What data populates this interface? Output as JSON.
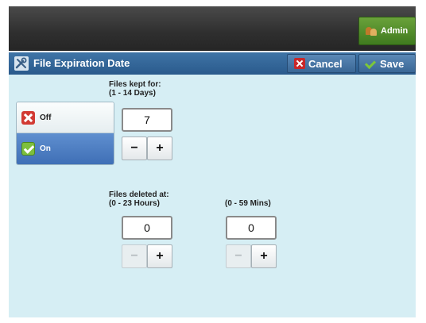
{
  "topbar": {
    "admin_label": "Admin"
  },
  "titlebar": {
    "title": "File Expiration Date",
    "cancel_label": "Cancel",
    "save_label": "Save"
  },
  "toggle": {
    "off_label": "Off",
    "on_label": "On",
    "selected": "On"
  },
  "kept": {
    "label_line1": "Files kept for:",
    "label_line2": "(1 - 14 Days)",
    "value": "7",
    "minus": "−",
    "plus": "+"
  },
  "deleted": {
    "label_line1": "Files deleted at:",
    "hours_range": "(0 - 23 Hours)",
    "mins_range": "(0 - 59 Mins)",
    "hours_value": "0",
    "mins_value": "0",
    "minus": "−",
    "plus": "+"
  },
  "colors": {
    "title_bar": "#2f609a",
    "content_bg": "#d6eef4",
    "admin_green": "#4f8a28",
    "selected_blue": "#4a7cc0"
  }
}
